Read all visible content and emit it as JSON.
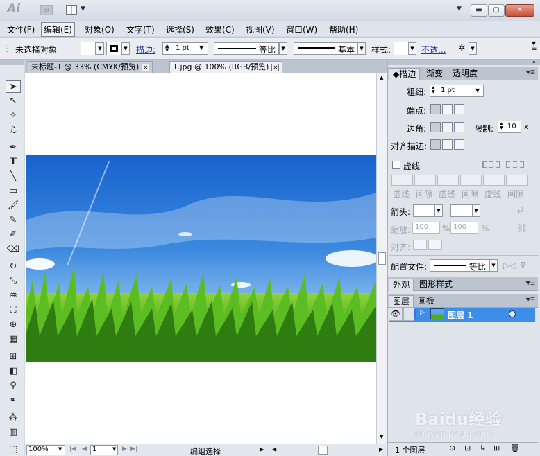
{
  "app": {
    "logo": "Ai",
    "bridge": "Br"
  },
  "window_controls": {
    "minimize": "▬",
    "maximize": "▢",
    "close": "✕"
  },
  "menu": [
    {
      "label": "文件(F)"
    },
    {
      "label": "编辑(E)"
    },
    {
      "label": "对象(O)"
    },
    {
      "label": "文字(T)"
    },
    {
      "label": "选择(S)"
    },
    {
      "label": "效果(C)"
    },
    {
      "label": "视图(V)"
    },
    {
      "label": "窗口(W)"
    },
    {
      "label": "帮助(H)"
    }
  ],
  "control_bar": {
    "selection": "未选择对象",
    "stroke_label": "描边:",
    "stroke_weight": "1 pt",
    "uniform": "等比",
    "basic": "基本",
    "style_label": "样式:",
    "opacity_link": "不透..."
  },
  "doc_tabs": [
    {
      "label": "未标题-1 @ 33% (CMYK/预览)"
    },
    {
      "label": "1.jpg @ 100% (RGB/预览)"
    }
  ],
  "stroke_panel": {
    "tabs": [
      "描边",
      "渐变",
      "透明度"
    ],
    "weight_label": "粗细:",
    "weight_value": "1 pt",
    "cap_label": "端点:",
    "corner_label": "边角:",
    "limit_label": "限制:",
    "limit_value": "10",
    "limit_unit": "x",
    "align_label": "对齐描边:",
    "dashed_label": "虚线",
    "dash_cols": [
      "虚线",
      "间隙",
      "虚线",
      "间隙",
      "虚线",
      "间隙"
    ],
    "arrow_label": "箭头:",
    "scale_label": "缩放:",
    "scale_start": "100",
    "scale_end": "100",
    "percent": "%",
    "align_arrow_label": "对齐:",
    "profile_label": "配置文件:",
    "profile_value": "等比"
  },
  "appearance_panel": {
    "tabs": [
      "外观",
      "图形样式"
    ]
  },
  "layers_panel": {
    "tabs": [
      "图层",
      "画板"
    ],
    "layers": [
      {
        "name": "图层 1"
      }
    ],
    "count": "1 个图层"
  },
  "status_bar": {
    "zoom": "100%",
    "page": "1",
    "status": "编组选择"
  },
  "watermark": {
    "brand": "Baidu经验",
    "url": "jingyan.baidu.com"
  },
  "colors": {
    "accent": "#3d8ee8",
    "panel": "#dfe3ea",
    "sky": "#1f6fd1",
    "grass": "#4fae1c"
  }
}
